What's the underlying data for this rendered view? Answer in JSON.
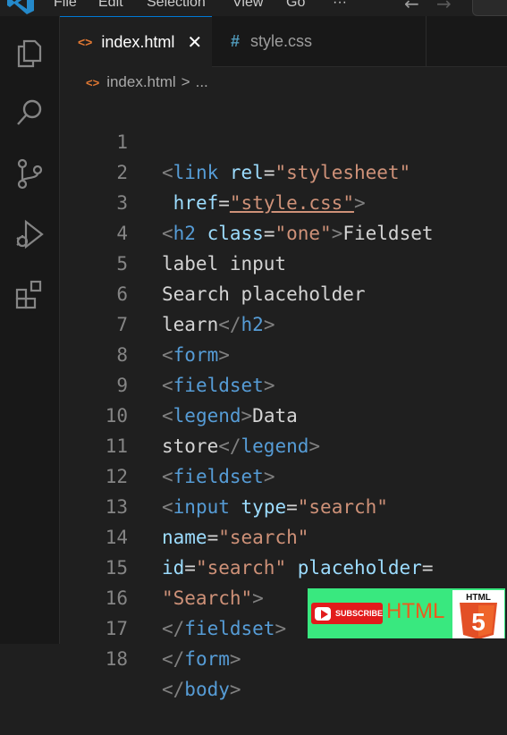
{
  "menu": [
    "File",
    "Edit",
    "Selection",
    "View",
    "Go",
    "···"
  ],
  "tabs": [
    {
      "icon": "<>",
      "label": "index.html",
      "close": "✕"
    },
    {
      "icon": "#",
      "label": "style.css"
    }
  ],
  "breadcrumb": {
    "icon": "<>",
    "file": "index.html",
    "sep": ">",
    "rest": "..."
  },
  "lines": [
    "1",
    "2",
    "3",
    "4",
    "5",
    "6",
    "7",
    "8",
    "9",
    "10",
    "11",
    "12",
    "13",
    "14",
    "15",
    "16",
    "17",
    "18"
  ],
  "code": {
    "l1_tag": "link",
    "l1_attr": "rel",
    "l1_val": "\"stylesheet\"",
    "l2_attr": "href",
    "l2_val": "\"style.css\"",
    "l3_tag": "h2",
    "l3_attr": "class",
    "l3_val": "\"one\"",
    "l3_text": "Fieldset",
    "l4_text": "label input",
    "l5_text": "Search placeholder",
    "l6_text": "learn",
    "l6_tag": "h2",
    "l7_tag": "form",
    "l8_tag": "fieldset",
    "l9_tag": "legend",
    "l9_text": "Data",
    "l10_text": "store",
    "l10_tag": "legend",
    "l11_tag": "fieldset",
    "l12_tag": "input",
    "l12_attr": "type",
    "l12_val": "\"search\"",
    "l13_attr": "name",
    "l13_val": "\"search\"",
    "l14_attr1": "id",
    "l14_val": "\"search\"",
    "l14_attr2": "placeholder",
    "l15_val": "\"Search\"",
    "l16_tag": "fieldset",
    "l17_tag": "form",
    "l18_tag": "body"
  },
  "promo": {
    "subscribe": "SUBSCRIBE",
    "html": "HTML",
    "badge_text": "HTML",
    "badge_num": "5"
  },
  "colors": {
    "accent": "#0078d4",
    "promo_bg": "#39e87f",
    "subscribe": "#e21b1b",
    "html5": "#e34f26"
  }
}
